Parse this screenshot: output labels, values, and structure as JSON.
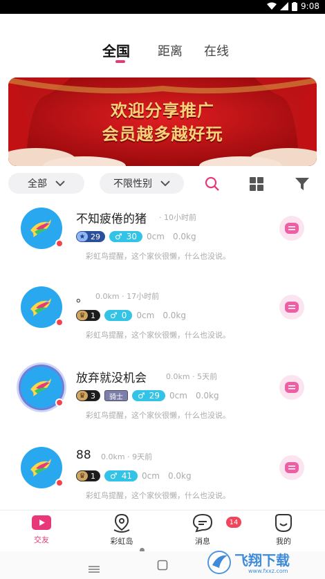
{
  "status_bar": {
    "time": "9:08"
  },
  "tabs": [
    {
      "label": "全国",
      "active": true
    },
    {
      "label": "距离",
      "active": false
    },
    {
      "label": "在线",
      "active": false
    }
  ],
  "banner": {
    "line1": "欢迎分享推广",
    "line2": "会员越多越好玩"
  },
  "filters": {
    "region": "全部",
    "gender": "不限性别"
  },
  "users": [
    {
      "name": "不知疲倦的猪",
      "meta": "· 10小时前",
      "level": "29",
      "level_style": "blue",
      "gender_value": "30",
      "height": "0cm",
      "weight": "0.0kg",
      "bio": "彩虹鸟提醒，这个家伙很懒，什么也没说。"
    },
    {
      "name": "。",
      "meta": "0.0km · 17小时前",
      "level": "1",
      "level_style": "brown",
      "gender_value": "0",
      "height": "0cm",
      "weight": "0.0kg",
      "bio": "彩虹鸟提醒，这个家伙很懒，什么也没说。"
    },
    {
      "name": "放弃就没机会",
      "meta": "0.0km · 5天前",
      "level": "3",
      "level_style": "brown",
      "title_badge": "骑士",
      "gender_value": "29",
      "height": "0cm",
      "weight": "0.0kg",
      "bio": "彩虹鸟提醒，这个家伙很懒，什么也没说。"
    },
    {
      "name": "88",
      "meta": "0.0km · 9天前",
      "level": "1",
      "level_style": "brown",
      "gender_value": "41",
      "height": "0cm",
      "weight": "0.0kg",
      "bio": "彩虹鸟提醒，这个家伙很懒，什么也没说。"
    }
  ],
  "bottom_nav": [
    {
      "label": "交友",
      "icon": "video-heart-icon",
      "active": true
    },
    {
      "label": "彩虹岛",
      "icon": "map-pin-icon",
      "active": false
    },
    {
      "label": "消息",
      "icon": "chat-bubble-icon",
      "active": false,
      "badge": "14"
    },
    {
      "label": "我的",
      "icon": "smile-face-icon",
      "active": false
    }
  ],
  "colors": {
    "accent": "#e8387a",
    "gender_male": "#32c3e6",
    "avatar_bg": "#2aa8ef",
    "banner_red": "#a80c10",
    "banner_gold": "#f6d27a"
  },
  "watermark": {
    "text": "飞翔下载",
    "url": "www.fxxz.com"
  }
}
